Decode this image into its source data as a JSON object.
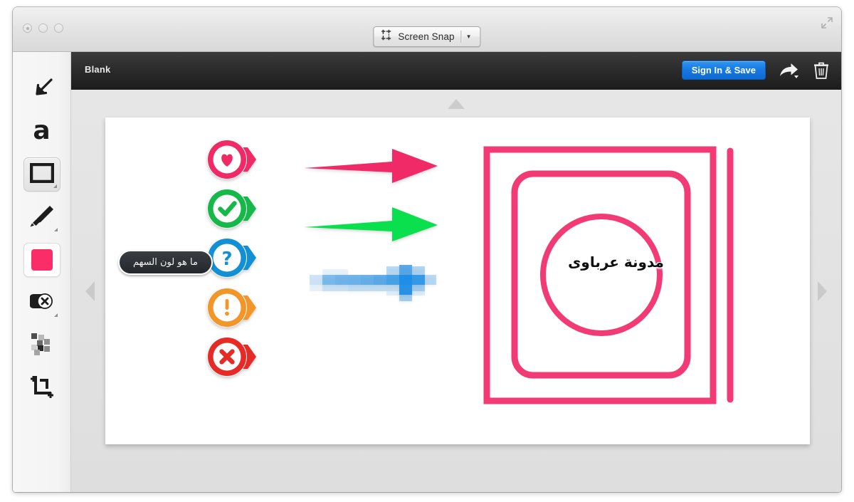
{
  "window": {
    "traffic_lights": [
      "close",
      "minimize",
      "zoom"
    ],
    "fullscreen_icon": "fullscreen-icon",
    "snap_button": {
      "icon": "crop-frame-icon",
      "label": "Screen Snap",
      "caret": "▼"
    }
  },
  "editor": {
    "document_title": "Blank",
    "sign_in_save_label": "Sign In & Save",
    "share_icon": "share-arrow-icon",
    "trash_icon": "trash-icon",
    "accent_blue": "#1678e0"
  },
  "toolbar": {
    "items": [
      {
        "id": "arrow",
        "name": "arrow-tool",
        "label": "Arrow",
        "selected": false,
        "has_options": false
      },
      {
        "id": "text",
        "name": "text-tool",
        "label": "a",
        "selected": false,
        "has_options": false
      },
      {
        "id": "shape",
        "name": "shape-tool",
        "label": "Shape",
        "selected": true,
        "has_options": true
      },
      {
        "id": "marker",
        "name": "marker-tool",
        "label": "Marker",
        "selected": false,
        "has_options": true
      },
      {
        "id": "color",
        "name": "color-tool",
        "label": "Color",
        "selected": true,
        "has_options": false
      },
      {
        "id": "sticker",
        "name": "sticker-tool",
        "label": "Sticker",
        "selected": false,
        "has_options": true
      },
      {
        "id": "pixelate",
        "name": "pixelate-tool",
        "label": "Pixelate",
        "selected": false,
        "has_options": false
      },
      {
        "id": "crop",
        "name": "crop-tool",
        "label": "Crop",
        "selected": false,
        "has_options": false
      }
    ],
    "current_color": "#fa2d68"
  },
  "stage": {
    "nav_up": "▲",
    "nav_left": "◀",
    "nav_right": "▶"
  },
  "canvas": {
    "stickers": [
      {
        "id": "heart",
        "glyph": "heart",
        "color": "#ef2a66"
      },
      {
        "id": "check",
        "glyph": "check",
        "color": "#16b84a"
      },
      {
        "id": "question",
        "glyph": "?",
        "color": "#1390d4"
      },
      {
        "id": "warning",
        "glyph": "!",
        "color": "#f2962a"
      },
      {
        "id": "error",
        "glyph": "x",
        "color": "#e62b26"
      }
    ],
    "tooltip": {
      "text": "ما هو لون السهم"
    },
    "arrows": [
      {
        "id": "pink",
        "color": "#ef2a66",
        "blurred": false
      },
      {
        "id": "green",
        "color": "#0ae04e",
        "blurred": false
      },
      {
        "id": "blue",
        "color": "#1e8ee6",
        "blurred": true
      }
    ],
    "shapes": {
      "outer_square_color": "#f23a74",
      "inner_square_color": "#f23a74",
      "circle_color": "#f23a74",
      "line_color": "#f23a74",
      "label": "مدونة عرباوى"
    }
  }
}
